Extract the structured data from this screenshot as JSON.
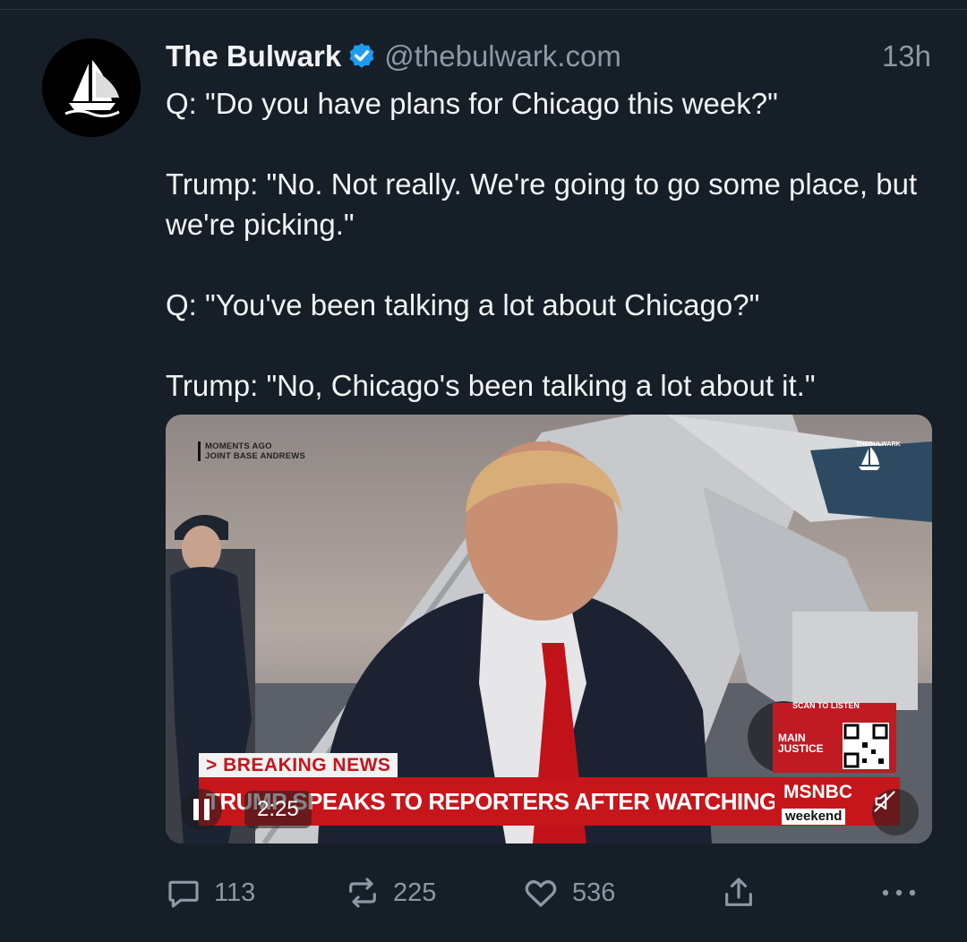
{
  "post": {
    "author_name": "The Bulwark",
    "handle": "@thebulwark.com",
    "time": "13h",
    "paragraphs": [
      "Q: \"Do you have plans for Chicago this week?\"",
      "Trump: \"No. Not really. We're going to go some place, but we're picking.\"",
      "Q: \"You've been talking a lot about Chicago?\"",
      "Trump: \"No, Chicago's been talking a lot about it.\""
    ]
  },
  "video": {
    "bug_line1": "MOMENTS AGO",
    "bug_line2": "JOINT BASE ANDREWS",
    "corner_logo": "THEBULWARK",
    "breaking": "> BREAKING NEWS",
    "headline": "TRUMP SPEAKS TO REPORTERS AFTER WATCHING U.S. OPEN",
    "network": "MSNBC",
    "show": "weekend",
    "qr_label": "SCAN TO LISTEN",
    "qr_title": "MAIN JUSTICE",
    "duration": "2:25"
  },
  "actions": {
    "replies": "113",
    "reposts": "225",
    "likes": "536"
  },
  "colors": {
    "background": "#161e27",
    "text": "#f1f3f5",
    "muted": "#8b98a5",
    "verified": "#1d9bf0",
    "chyron_red": "#c6161c"
  },
  "icons": [
    "verified-badge-icon",
    "reply-icon",
    "repost-icon",
    "like-icon",
    "share-icon",
    "more-icon",
    "pause-icon",
    "mute-icon"
  ]
}
